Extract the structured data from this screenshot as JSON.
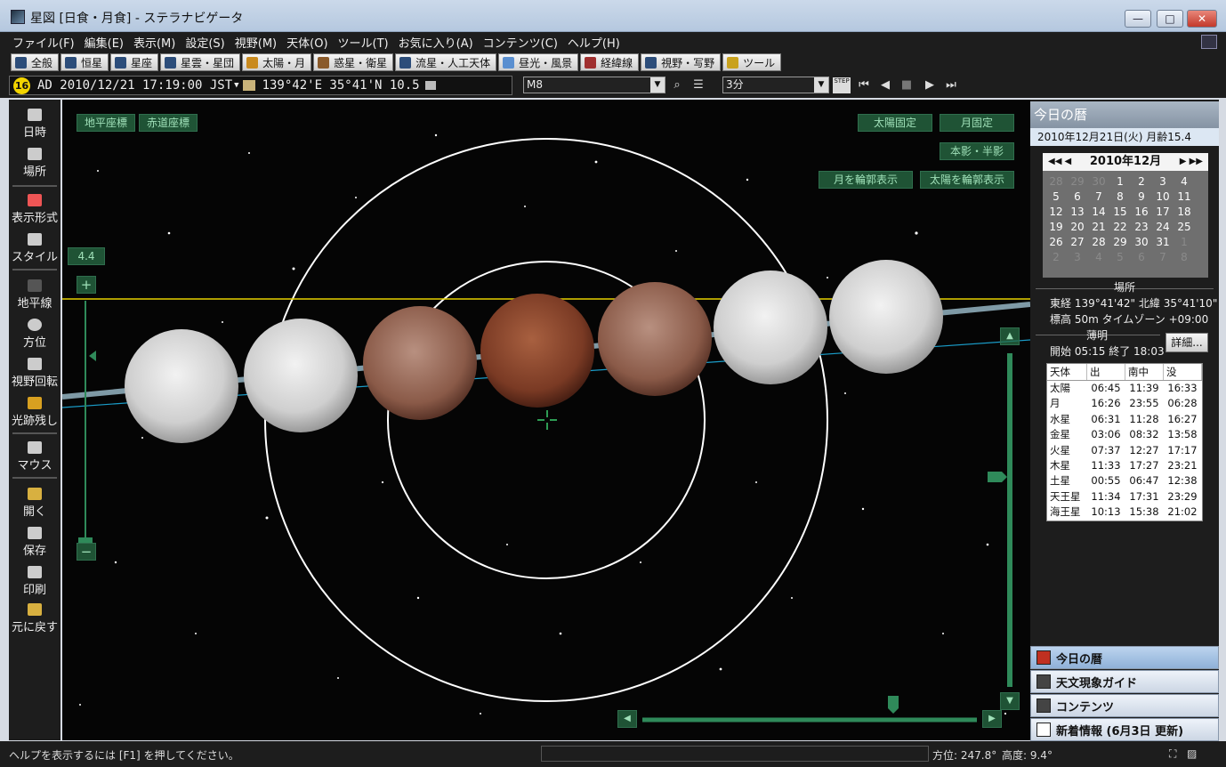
{
  "window": {
    "title": "星図 [日食・月食] - ステラナビゲータ",
    "minimize": "—",
    "maximize": "□",
    "close": "✕"
  },
  "menu": [
    "ファイル(F)",
    "編集(E)",
    "表示(M)",
    "設定(S)",
    "視野(M)",
    "天体(O)",
    "ツール(T)",
    "お気に入り(A)",
    "コンテンツ(C)",
    "ヘルプ(H)"
  ],
  "tabs": [
    "全般",
    "恒星",
    "星座",
    "星雲・星団",
    "太陽・月",
    "惑星・衛星",
    "流星・人工天体",
    "昼光・風景",
    "経緯線",
    "視野・写野",
    "ツール"
  ],
  "toolbar": {
    "badge": "16",
    "datetime": "AD 2010/12/21 17:19:00 JST",
    "location": "139°42'E 35°41'N 10.5",
    "object_combo": "M8",
    "step_combo": "3分",
    "step_label": "STEP"
  },
  "left_panel": [
    {
      "label": "日時",
      "icon": "clock-icon"
    },
    {
      "label": "場所",
      "icon": "location-icon"
    },
    {
      "label": "表示形式",
      "icon": "display-format-icon"
    },
    {
      "label": "スタイル",
      "icon": "style-icon"
    },
    {
      "label": "地平線",
      "icon": "horizon-icon"
    },
    {
      "label": "方位",
      "icon": "compass-icon"
    },
    {
      "label": "視野回転",
      "icon": "rotate-icon"
    },
    {
      "label": "光跡残し",
      "icon": "trail-icon"
    },
    {
      "label": "マウス",
      "icon": "mouse-icon"
    },
    {
      "label": "開く",
      "icon": "open-folder-icon"
    },
    {
      "label": "保存",
      "icon": "save-icon"
    },
    {
      "label": "印刷",
      "icon": "print-icon"
    },
    {
      "label": "元に戻す",
      "icon": "undo-icon"
    }
  ],
  "sky": {
    "btn_horizontal": "地平座標",
    "btn_equatorial": "赤道座標",
    "btn_sun_fixed": "太陽固定",
    "btn_moon_fixed": "月固定",
    "btn_umbra": "本影・半影",
    "btn_moon_outline": "月を輪郭表示",
    "btn_sun_outline": "太陽を輪郭表示",
    "zoom_value": "4.4",
    "zoom_plus": "+",
    "zoom_minus": "−"
  },
  "right_panel": {
    "header": "今日の暦",
    "date": "2010年12月21日(火)  月齢15.4",
    "calendar": {
      "month": "2010年12月",
      "nav_prev": "◀◀ ◀",
      "nav_next": "▶ ▶▶",
      "rows": [
        [
          "28",
          "29",
          "30",
          "1",
          "2",
          "3",
          "4"
        ],
        [
          "5",
          "6",
          "7",
          "8",
          "9",
          "10",
          "11"
        ],
        [
          "12",
          "13",
          "14",
          "15",
          "16",
          "17",
          "18"
        ],
        [
          "19",
          "20",
          "21",
          "22",
          "23",
          "24",
          "25"
        ],
        [
          "26",
          "27",
          "28",
          "29",
          "30",
          "31",
          "1"
        ],
        [
          "2",
          "3",
          "4",
          "5",
          "6",
          "7",
          "8"
        ]
      ]
    },
    "place_title": "場所",
    "place_line1": "東経 139°41'42\" 北緯 35°41'10\"",
    "place_line2": "標高 50m   タイムゾーン +09:00",
    "twilight_title": "薄明",
    "twilight_line": "開始 05:15  終了 18:03",
    "detail_button": "詳細...",
    "table": {
      "headers": [
        "天体",
        "出",
        "南中",
        "没"
      ],
      "rows": [
        [
          "太陽",
          "06:45",
          "11:39",
          "16:33"
        ],
        [
          "月",
          "16:26",
          "23:55",
          "06:28"
        ],
        [
          "水星",
          "06:31",
          "11:28",
          "16:27"
        ],
        [
          "金星",
          "03:06",
          "08:32",
          "13:58"
        ],
        [
          "火星",
          "07:37",
          "12:27",
          "17:17"
        ],
        [
          "木星",
          "11:33",
          "17:27",
          "23:21"
        ],
        [
          "土星",
          "00:55",
          "06:47",
          "12:38"
        ],
        [
          "天王星",
          "11:34",
          "17:31",
          "23:29"
        ],
        [
          "海王星",
          "10:13",
          "15:38",
          "21:02"
        ]
      ]
    },
    "bottom_tabs": [
      "今日の暦",
      "天文現象ガイド",
      "コンテンツ",
      "新着情報 (6月3日 更新)"
    ]
  },
  "status": {
    "help": "ヘルプを表示するには [F1] を押してください。",
    "azimuth": "方位: 247.8°",
    "altitude": "高度:    9.4°"
  },
  "colors": {
    "accent_green": "#2f7a52",
    "horizon_yellow": "#e6d200",
    "eclipse_red": "#7a3a24"
  }
}
